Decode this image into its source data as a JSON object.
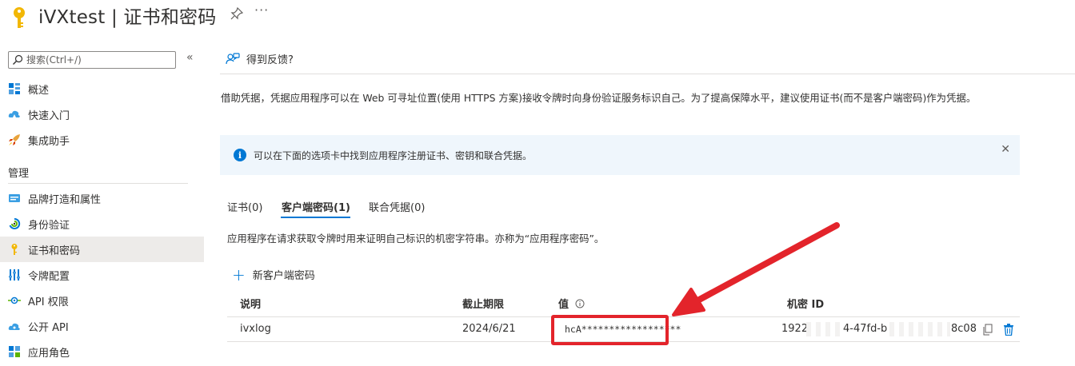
{
  "header": {
    "title": "iVXtest | 证书和密码",
    "more_label": "···"
  },
  "sidebar": {
    "search_placeholder": "搜索(Ctrl+/)",
    "collapse_label": "«",
    "items_top": [
      {
        "label": "概述",
        "icon": "overview-icon"
      },
      {
        "label": "快速入门",
        "icon": "quickstart-cloud-icon"
      },
      {
        "label": "集成助手",
        "icon": "rocket-icon"
      }
    ],
    "section_label": "管理",
    "items_manage": [
      {
        "label": "品牌打造和属性",
        "icon": "branding-icon"
      },
      {
        "label": "身份验证",
        "icon": "authentication-icon"
      },
      {
        "label": "证书和密码",
        "icon": "key-icon",
        "active": true
      },
      {
        "label": "令牌配置",
        "icon": "token-config-icon"
      },
      {
        "label": "API 权限",
        "icon": "api-permissions-icon"
      },
      {
        "label": "公开 API",
        "icon": "expose-api-cloud-icon"
      },
      {
        "label": "应用角色",
        "icon": "app-roles-icon"
      }
    ]
  },
  "main": {
    "feedback_label": "得到反馈?",
    "description": "借助凭据，凭据应用程序可以在 Web 可寻址位置(使用 HTTPS 方案)接收令牌时向身份验证服务标识自己。为了提高保障水平，建议使用证书(而不是客户端密码)作为凭据。",
    "infobar_text": "可以在下面的选项卡中找到应用程序注册证书、密钥和联合凭据。",
    "infobar_close": "✕",
    "tabs": [
      {
        "label": "证书(0)"
      },
      {
        "label": "客户端密码(1)",
        "active": true
      },
      {
        "label": "联合凭据(0)"
      }
    ],
    "tab_description": "应用程序在请求获取令牌时用来证明自己标识的机密字符串。亦称为“应用程序密码”。",
    "new_secret_label": "新客户端密码",
    "table": {
      "headers": {
        "description": "说明",
        "expires": "截止期限",
        "value": "值",
        "secret_id": "机密 ID"
      },
      "rows": [
        {
          "description": "ivxlog",
          "expires": "2024/6/21",
          "value": "hcA******************",
          "secret_id_visible_start": "1922",
          "secret_id_visible_mid": "4-47fd-b",
          "secret_id_visible_end": "8c08"
        }
      ]
    }
  },
  "colors": {
    "accent": "#0078d4",
    "annotation_red": "#e3242b",
    "info_bg": "#eff6fc",
    "active_nav_bg": "#edebe9",
    "key_gold": "#f2b705"
  }
}
